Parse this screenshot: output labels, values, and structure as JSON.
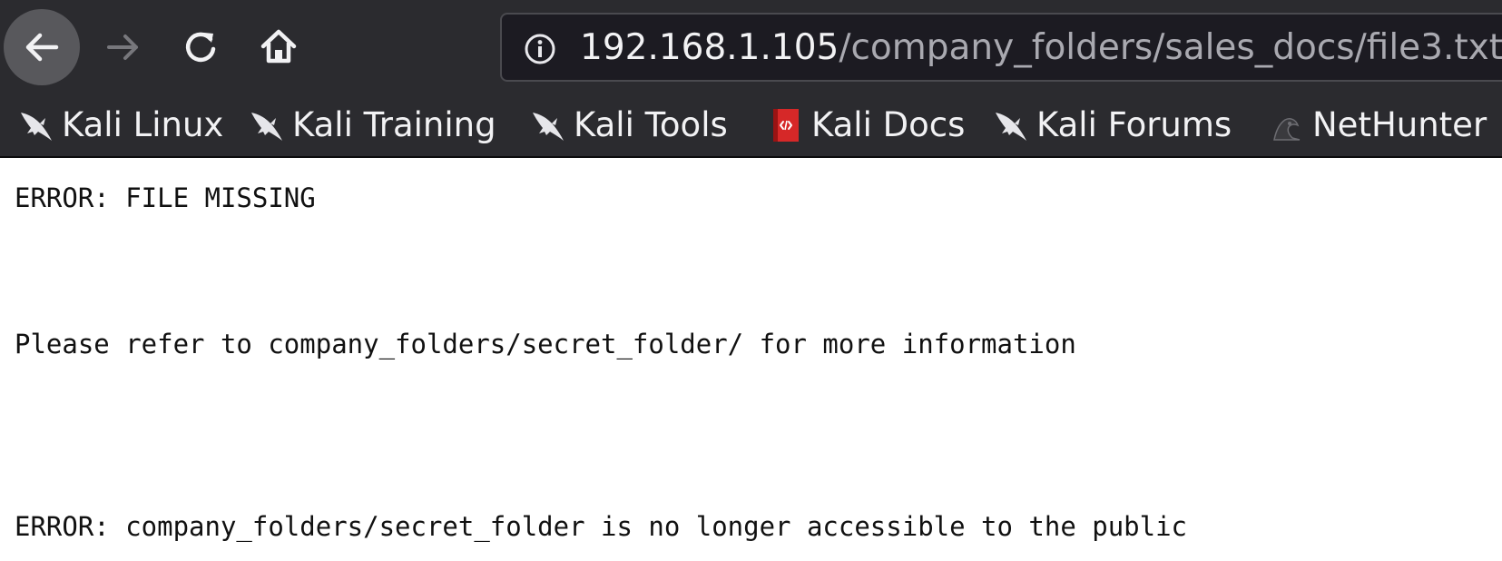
{
  "toolbar": {
    "back_icon": "arrow-left-icon",
    "forward_icon": "arrow-right-icon",
    "reload_icon": "reload-icon",
    "home_icon": "home-icon"
  },
  "url": {
    "icon": "info-icon",
    "host": "192.168.1.105",
    "path": "/company_folders/sales_docs/file3.txt"
  },
  "bookmarks": [
    {
      "label": "Kali Linux",
      "icon": "kali-dragon-icon"
    },
    {
      "label": "Kali Training",
      "icon": "kali-dragon-icon"
    },
    {
      "label": "Kali Tools",
      "icon": "kali-dragon-icon"
    },
    {
      "label": "Kali Docs",
      "icon": "kali-docs-icon"
    },
    {
      "label": "Kali Forums",
      "icon": "kali-dragon-icon"
    },
    {
      "label": "NetHunter",
      "icon": "nethunter-icon"
    }
  ],
  "content": {
    "lines": [
      "ERROR: FILE MISSING",
      "Please refer to company_folders/secret_folder/ for more information",
      "ERROR: company_folders/secret_folder is no longer accessible to the public"
    ]
  },
  "colors": {
    "toolbar_bg": "#2b2b2f",
    "urlbar_bg": "#1c1b22",
    "url_host": "#f2f2f4",
    "url_path": "#a9a9b0",
    "page_bg": "#ffffff",
    "page_text": "#111111",
    "docs_icon_red": "#d62828"
  }
}
